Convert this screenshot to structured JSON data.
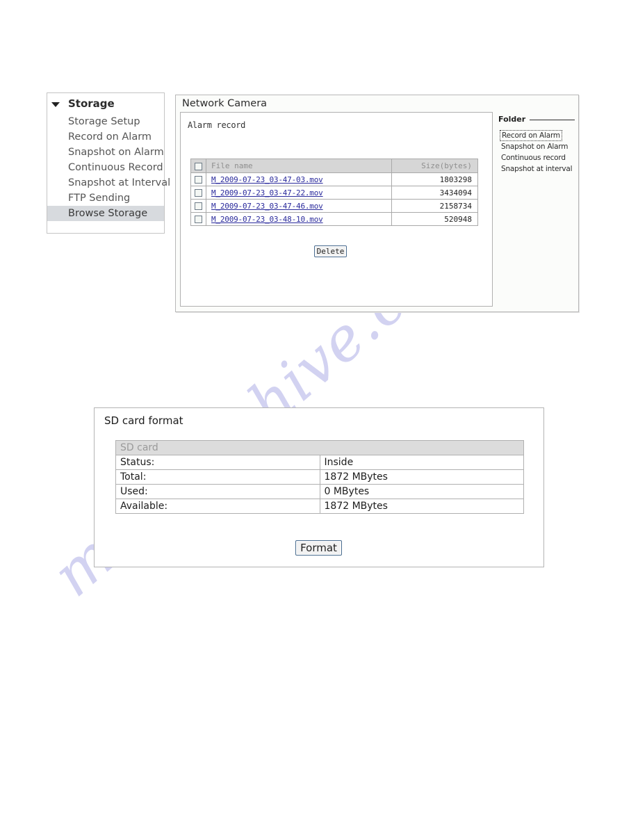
{
  "watermark": {
    "text": "manualshive.com"
  },
  "sidebar": {
    "title": "Storage",
    "toggle_icon": "triangle-down-icon",
    "items": [
      {
        "label": "Storage Setup",
        "active": false
      },
      {
        "label": "Record on Alarm",
        "active": false
      },
      {
        "label": "Snapshot on Alarm",
        "active": false
      },
      {
        "label": "Continuous Record",
        "active": false
      },
      {
        "label": "Snapshot at Interval",
        "active": false
      },
      {
        "label": "FTP Sending",
        "active": false
      },
      {
        "label": "Browse Storage",
        "active": true
      }
    ]
  },
  "camera_panel": {
    "title": "Network Camera",
    "section_label": "Alarm record",
    "table": {
      "headers": [
        "",
        "File name",
        "Size(bytes)"
      ],
      "header_checkbox": "select-all-checkbox",
      "rows": [
        {
          "checked": false,
          "name": "M_2009-07-23_03-47-03.mov",
          "size": "1803298"
        },
        {
          "checked": false,
          "name": "M_2009-07-23_03-47-22.mov",
          "size": "3434094"
        },
        {
          "checked": false,
          "name": "M_2009-07-23_03-47-46.mov",
          "size": "2158734"
        },
        {
          "checked": false,
          "name": "M_2009-07-23_03-48-10.mov",
          "size": "520948"
        }
      ]
    },
    "delete_label": "Delete",
    "folder": {
      "heading": "Folder",
      "items": [
        {
          "label": "Record on Alarm",
          "selected": true
        },
        {
          "label": "Snapshot on Alarm",
          "selected": false
        },
        {
          "label": "Continuous record",
          "selected": false
        },
        {
          "label": "Snapshot at interval",
          "selected": false
        }
      ]
    }
  },
  "sd_panel": {
    "title": "SD card format",
    "table_header": "SD card",
    "rows": [
      {
        "key": "Status:",
        "value": "Inside"
      },
      {
        "key": "Total:",
        "value": "1872 MBytes"
      },
      {
        "key": "Used:",
        "value": "0 MBytes"
      },
      {
        "key": "Available:",
        "value": "1872 MBytes"
      }
    ],
    "format_label": "Format"
  },
  "colors": {
    "link": "#2a2a9c",
    "header_bg": "#d6d6d6",
    "active_item_bg": "#d7dade",
    "button_border": "#486b8e",
    "watermark": "#c9c9ee"
  }
}
